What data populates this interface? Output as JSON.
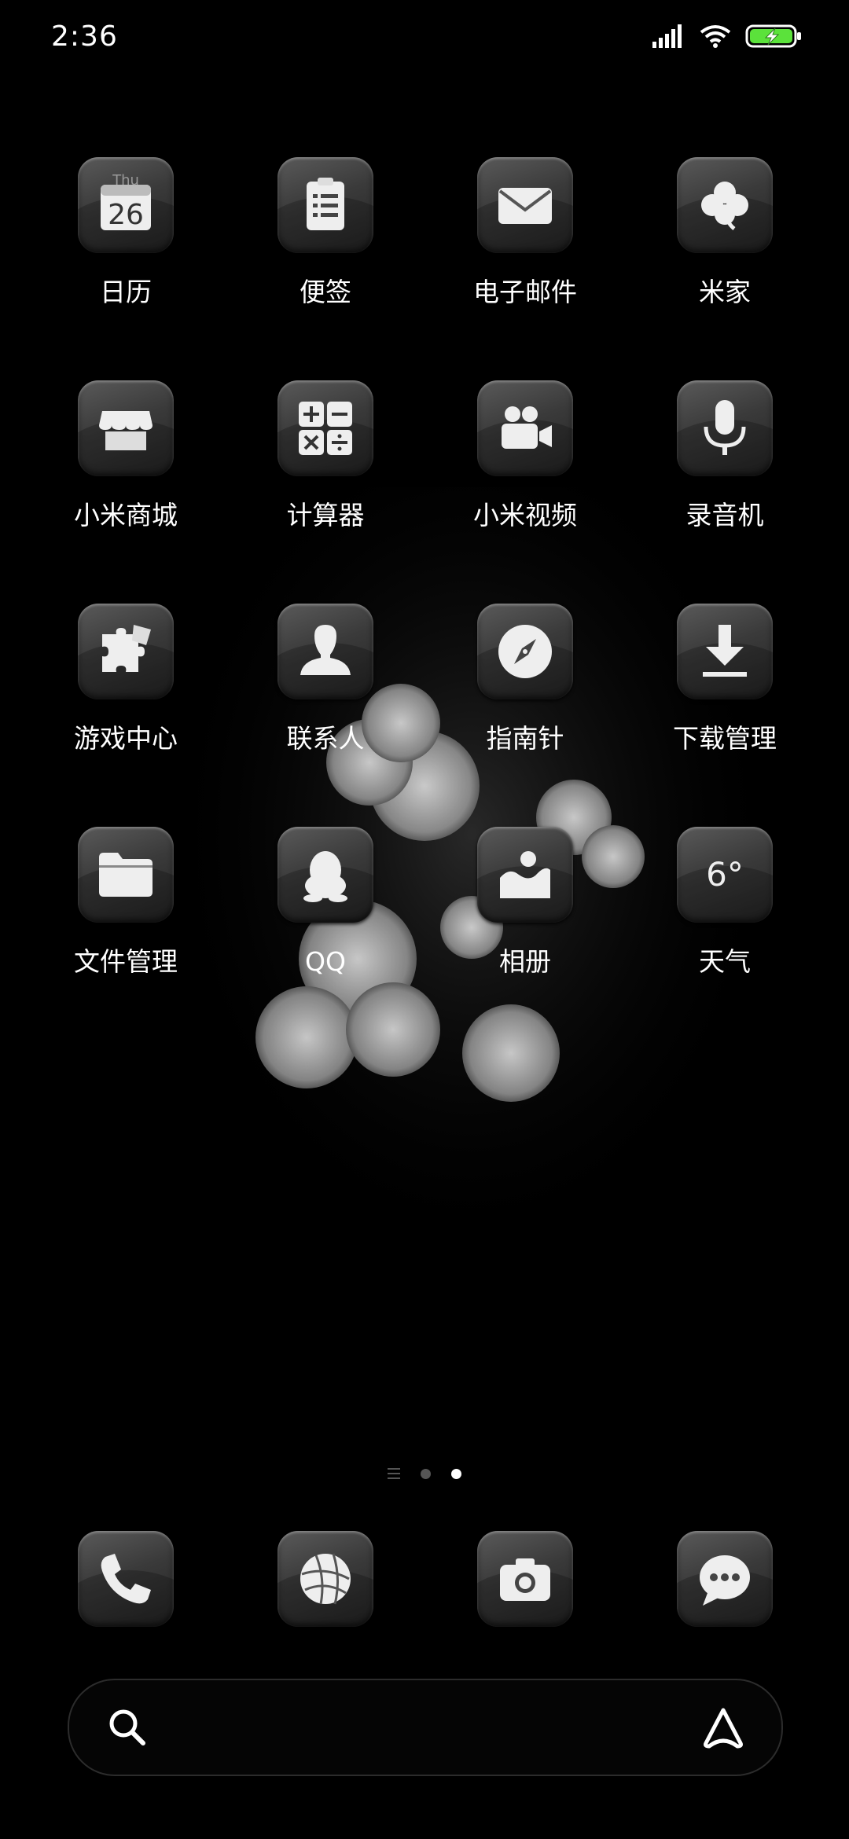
{
  "status_bar": {
    "time": "2:36",
    "icons": [
      "signal-icon",
      "wifi-icon",
      "battery-charging-icon"
    ],
    "battery_color": "#5be23b"
  },
  "apps": [
    {
      "label": "日历",
      "icon": "calendar-icon",
      "icon_day": "Thu",
      "icon_date": "26"
    },
    {
      "label": "便签",
      "icon": "notes-icon"
    },
    {
      "label": "电子邮件",
      "icon": "mail-icon"
    },
    {
      "label": "米家",
      "icon": "clover-icon"
    },
    {
      "label": "小米商城",
      "icon": "store-icon"
    },
    {
      "label": "计算器",
      "icon": "calculator-icon"
    },
    {
      "label": "小米视频",
      "icon": "video-camera-icon"
    },
    {
      "label": "录音机",
      "icon": "microphone-icon"
    },
    {
      "label": "游戏中心",
      "icon": "puzzle-icon"
    },
    {
      "label": "联系人",
      "icon": "contact-icon"
    },
    {
      "label": "指南针",
      "icon": "compass-icon"
    },
    {
      "label": "下载管理",
      "icon": "download-icon"
    },
    {
      "label": "文件管理",
      "icon": "folder-icon"
    },
    {
      "label": "QQ",
      "icon": "qq-penguin-icon"
    },
    {
      "label": "相册",
      "icon": "gallery-icon"
    },
    {
      "label": "天气",
      "icon": "weather-icon",
      "icon_text": "6°"
    }
  ],
  "page_indicator": {
    "pages": 2,
    "active_page": 2
  },
  "dock": [
    {
      "icon": "phone-icon"
    },
    {
      "icon": "browser-globe-icon"
    },
    {
      "icon": "camera-icon"
    },
    {
      "icon": "messages-icon"
    }
  ],
  "search": {
    "placeholder": ""
  }
}
